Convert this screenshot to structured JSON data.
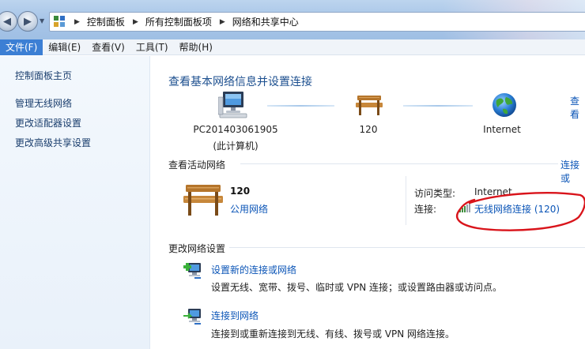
{
  "breadcrumbs": [
    "控制面板",
    "所有控制面板项",
    "网络和共享中心"
  ],
  "menu": [
    {
      "label": "文件(F)",
      "active": true
    },
    {
      "label": "编辑(E)",
      "active": false
    },
    {
      "label": "查看(V)",
      "active": false
    },
    {
      "label": "工具(T)",
      "active": false
    },
    {
      "label": "帮助(H)",
      "active": false
    }
  ],
  "sidebar": {
    "home": "控制面板主页",
    "items": [
      "管理无线网络",
      "更改适配器设置",
      "更改高级共享设置"
    ]
  },
  "main": {
    "heading": "查看基本网络信息并设置连接",
    "see_full_map": "查看",
    "map": {
      "computer_name": "PC201403061905",
      "computer_sub": "(此计算机)",
      "network_name": "120",
      "internet": "Internet"
    },
    "active_networks": {
      "title": "查看活动网络",
      "connect_link": "连接或",
      "network_name": "120",
      "network_type": "公用网络",
      "access_type_label": "访问类型:",
      "access_type_value": "Internet",
      "connection_label": "连接:",
      "connection_value": "无线网络连接 (120)"
    },
    "change_settings": {
      "title": "更改网络设置",
      "tasks": [
        {
          "title": "设置新的连接或网络",
          "desc": "设置无线、宽带、拨号、临时或 VPN 连接；或设置路由器或访问点。"
        },
        {
          "title": "连接到网络",
          "desc": "连接到或重新连接到无线、有线、拨号或 VPN 网络连接。"
        }
      ]
    }
  },
  "colors": {
    "link": "#0b55b7",
    "heading": "#1c4f8f",
    "annotation": "#d9141b"
  }
}
